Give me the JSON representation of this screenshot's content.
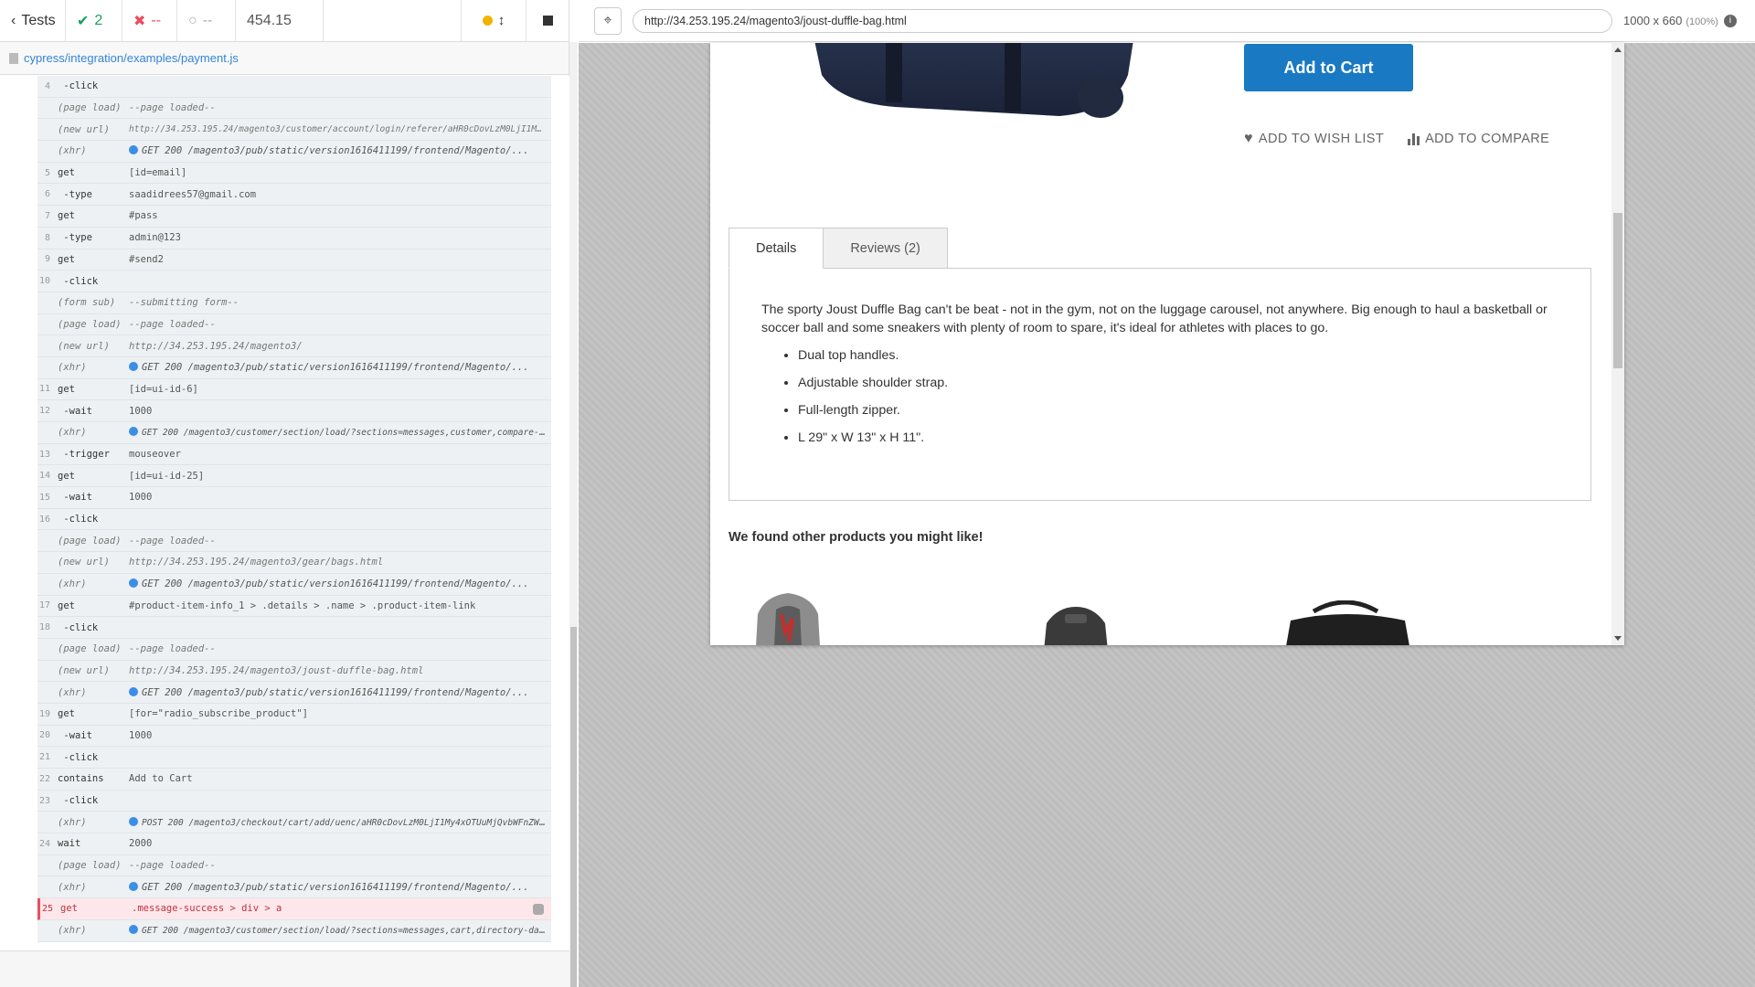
{
  "reporter": {
    "tests_label": "Tests",
    "passed_count": "2",
    "failed_count": "--",
    "pending_count": "--",
    "duration": "454.15",
    "spec_path": "cypress/integration/examples/payment.js"
  },
  "commands": [
    {
      "num": "4",
      "name": " -click",
      "msg": "",
      "kind": "cmd"
    },
    {
      "num": "",
      "name": "(page load)",
      "msg": "--page loaded--",
      "kind": "event"
    },
    {
      "num": "",
      "name": "(new url)",
      "msg": "http://34.253.195.24/magento3/customer/account/login/referer/aHR0cDovLzM0LjI1M...",
      "kind": "url"
    },
    {
      "num": "",
      "name": "(xhr)",
      "msg": "GET 200 /magento3/pub/static/version1616411199/frontend/Magento/...",
      "kind": "xhr"
    },
    {
      "num": "5",
      "name": "get",
      "msg": "[id=email]",
      "kind": "cmd"
    },
    {
      "num": "6",
      "name": " -type",
      "msg": "saadidrees57@gmail.com",
      "kind": "cmd"
    },
    {
      "num": "7",
      "name": "get",
      "msg": "#pass",
      "kind": "cmd"
    },
    {
      "num": "8",
      "name": " -type",
      "msg": "admin@123",
      "kind": "cmd"
    },
    {
      "num": "9",
      "name": "get",
      "msg": "#send2",
      "kind": "cmd"
    },
    {
      "num": "10",
      "name": " -click",
      "msg": "",
      "kind": "cmd"
    },
    {
      "num": "",
      "name": "(form sub)",
      "msg": "--submitting form--",
      "kind": "event"
    },
    {
      "num": "",
      "name": "(page load)",
      "msg": "--page loaded--",
      "kind": "event"
    },
    {
      "num": "",
      "name": "(new url)",
      "msg": "http://34.253.195.24/magento3/",
      "kind": "event"
    },
    {
      "num": "",
      "name": "(xhr)",
      "msg": "GET 200 /magento3/pub/static/version1616411199/frontend/Magento/...",
      "kind": "xhr"
    },
    {
      "num": "11",
      "name": "get",
      "msg": "[id=ui-id-6]",
      "kind": "cmd"
    },
    {
      "num": "12",
      "name": " -wait",
      "msg": "1000",
      "kind": "cmd"
    },
    {
      "num": "",
      "name": "(xhr)",
      "msg": "GET 200 /magento3/customer/section/load/?sections=messages,customer,compare-...",
      "kind": "xhr-small"
    },
    {
      "num": "13",
      "name": " -trigger",
      "msg": "mouseover",
      "kind": "cmd"
    },
    {
      "num": "14",
      "name": "get",
      "msg": "[id=ui-id-25]",
      "kind": "cmd"
    },
    {
      "num": "15",
      "name": " -wait",
      "msg": "1000",
      "kind": "cmd"
    },
    {
      "num": "16",
      "name": " -click",
      "msg": "",
      "kind": "cmd"
    },
    {
      "num": "",
      "name": "(page load)",
      "msg": "--page loaded--",
      "kind": "event"
    },
    {
      "num": "",
      "name": "(new url)",
      "msg": "http://34.253.195.24/magento3/gear/bags.html",
      "kind": "event"
    },
    {
      "num": "",
      "name": "(xhr)",
      "msg": "GET 200 /magento3/pub/static/version1616411199/frontend/Magento/...",
      "kind": "xhr"
    },
    {
      "num": "17",
      "name": "get",
      "msg": "#product-item-info_1 > .details > .name > .product-item-link",
      "kind": "cmd"
    },
    {
      "num": "18",
      "name": " -click",
      "msg": "",
      "kind": "cmd"
    },
    {
      "num": "",
      "name": "(page load)",
      "msg": "--page loaded--",
      "kind": "event"
    },
    {
      "num": "",
      "name": "(new url)",
      "msg": "http://34.253.195.24/magento3/joust-duffle-bag.html",
      "kind": "event"
    },
    {
      "num": "",
      "name": "(xhr)",
      "msg": "GET 200 /magento3/pub/static/version1616411199/frontend/Magento/...",
      "kind": "xhr"
    },
    {
      "num": "19",
      "name": "get",
      "msg": "[for=\"radio_subscribe_product\"]",
      "kind": "cmd"
    },
    {
      "num": "20",
      "name": " -wait",
      "msg": "1000",
      "kind": "cmd"
    },
    {
      "num": "21",
      "name": " -click",
      "msg": "",
      "kind": "cmd"
    },
    {
      "num": "22",
      "name": "contains",
      "msg": "Add to Cart",
      "kind": "cmd"
    },
    {
      "num": "23",
      "name": " -click",
      "msg": "",
      "kind": "cmd"
    },
    {
      "num": "",
      "name": "(xhr)",
      "msg": "POST 200 /magento3/checkout/cart/add/uenc/aHR0cDovLzM0LjI1My4xOTUuMjQvbWFnZW...",
      "kind": "xhr-small"
    },
    {
      "num": "24",
      "name": "wait",
      "msg": "2000",
      "kind": "cmd"
    },
    {
      "num": "",
      "name": "(page load)",
      "msg": "--page loaded--",
      "kind": "event"
    },
    {
      "num": "",
      "name": "(xhr)",
      "msg": "GET 200 /magento3/pub/static/version1616411199/frontend/Magento/...",
      "kind": "xhr"
    },
    {
      "num": "25",
      "name": "get",
      "msg": ".message-success > div > a",
      "kind": "failed"
    },
    {
      "num": "",
      "name": "(xhr)",
      "msg": "GET 200 /magento3/customer/section/load/?sections=messages,cart,directory-da...",
      "kind": "xhr-small"
    }
  ],
  "aut": {
    "url": "http://34.253.195.24/magento3/joust-duffle-bag.html",
    "viewport": "1000 x 660",
    "zoom": "(100%)"
  },
  "product": {
    "add_to_cart": "Add to Cart",
    "wishlist": "ADD TO WISH LIST",
    "compare": "ADD TO COMPARE",
    "tab_details": "Details",
    "tab_reviews": "Reviews (2)",
    "description": "The sporty Joust Duffle Bag can't be beat - not in the gym, not on the luggage carousel, not anywhere. Big enough to haul a basketball or soccer ball and some sneakers with plenty of room to spare, it's ideal for athletes with places to go.",
    "features": [
      "Dual top handles.",
      "Adjustable shoulder strap.",
      "Full-length zipper.",
      "L 29\" x W 13\" x H 11\"."
    ],
    "related_title": "We found other products you might like!"
  },
  "colors": {
    "accent_blue": "#1979c3",
    "passed_green": "#1aa05b",
    "failed_red": "#e94f5f"
  }
}
